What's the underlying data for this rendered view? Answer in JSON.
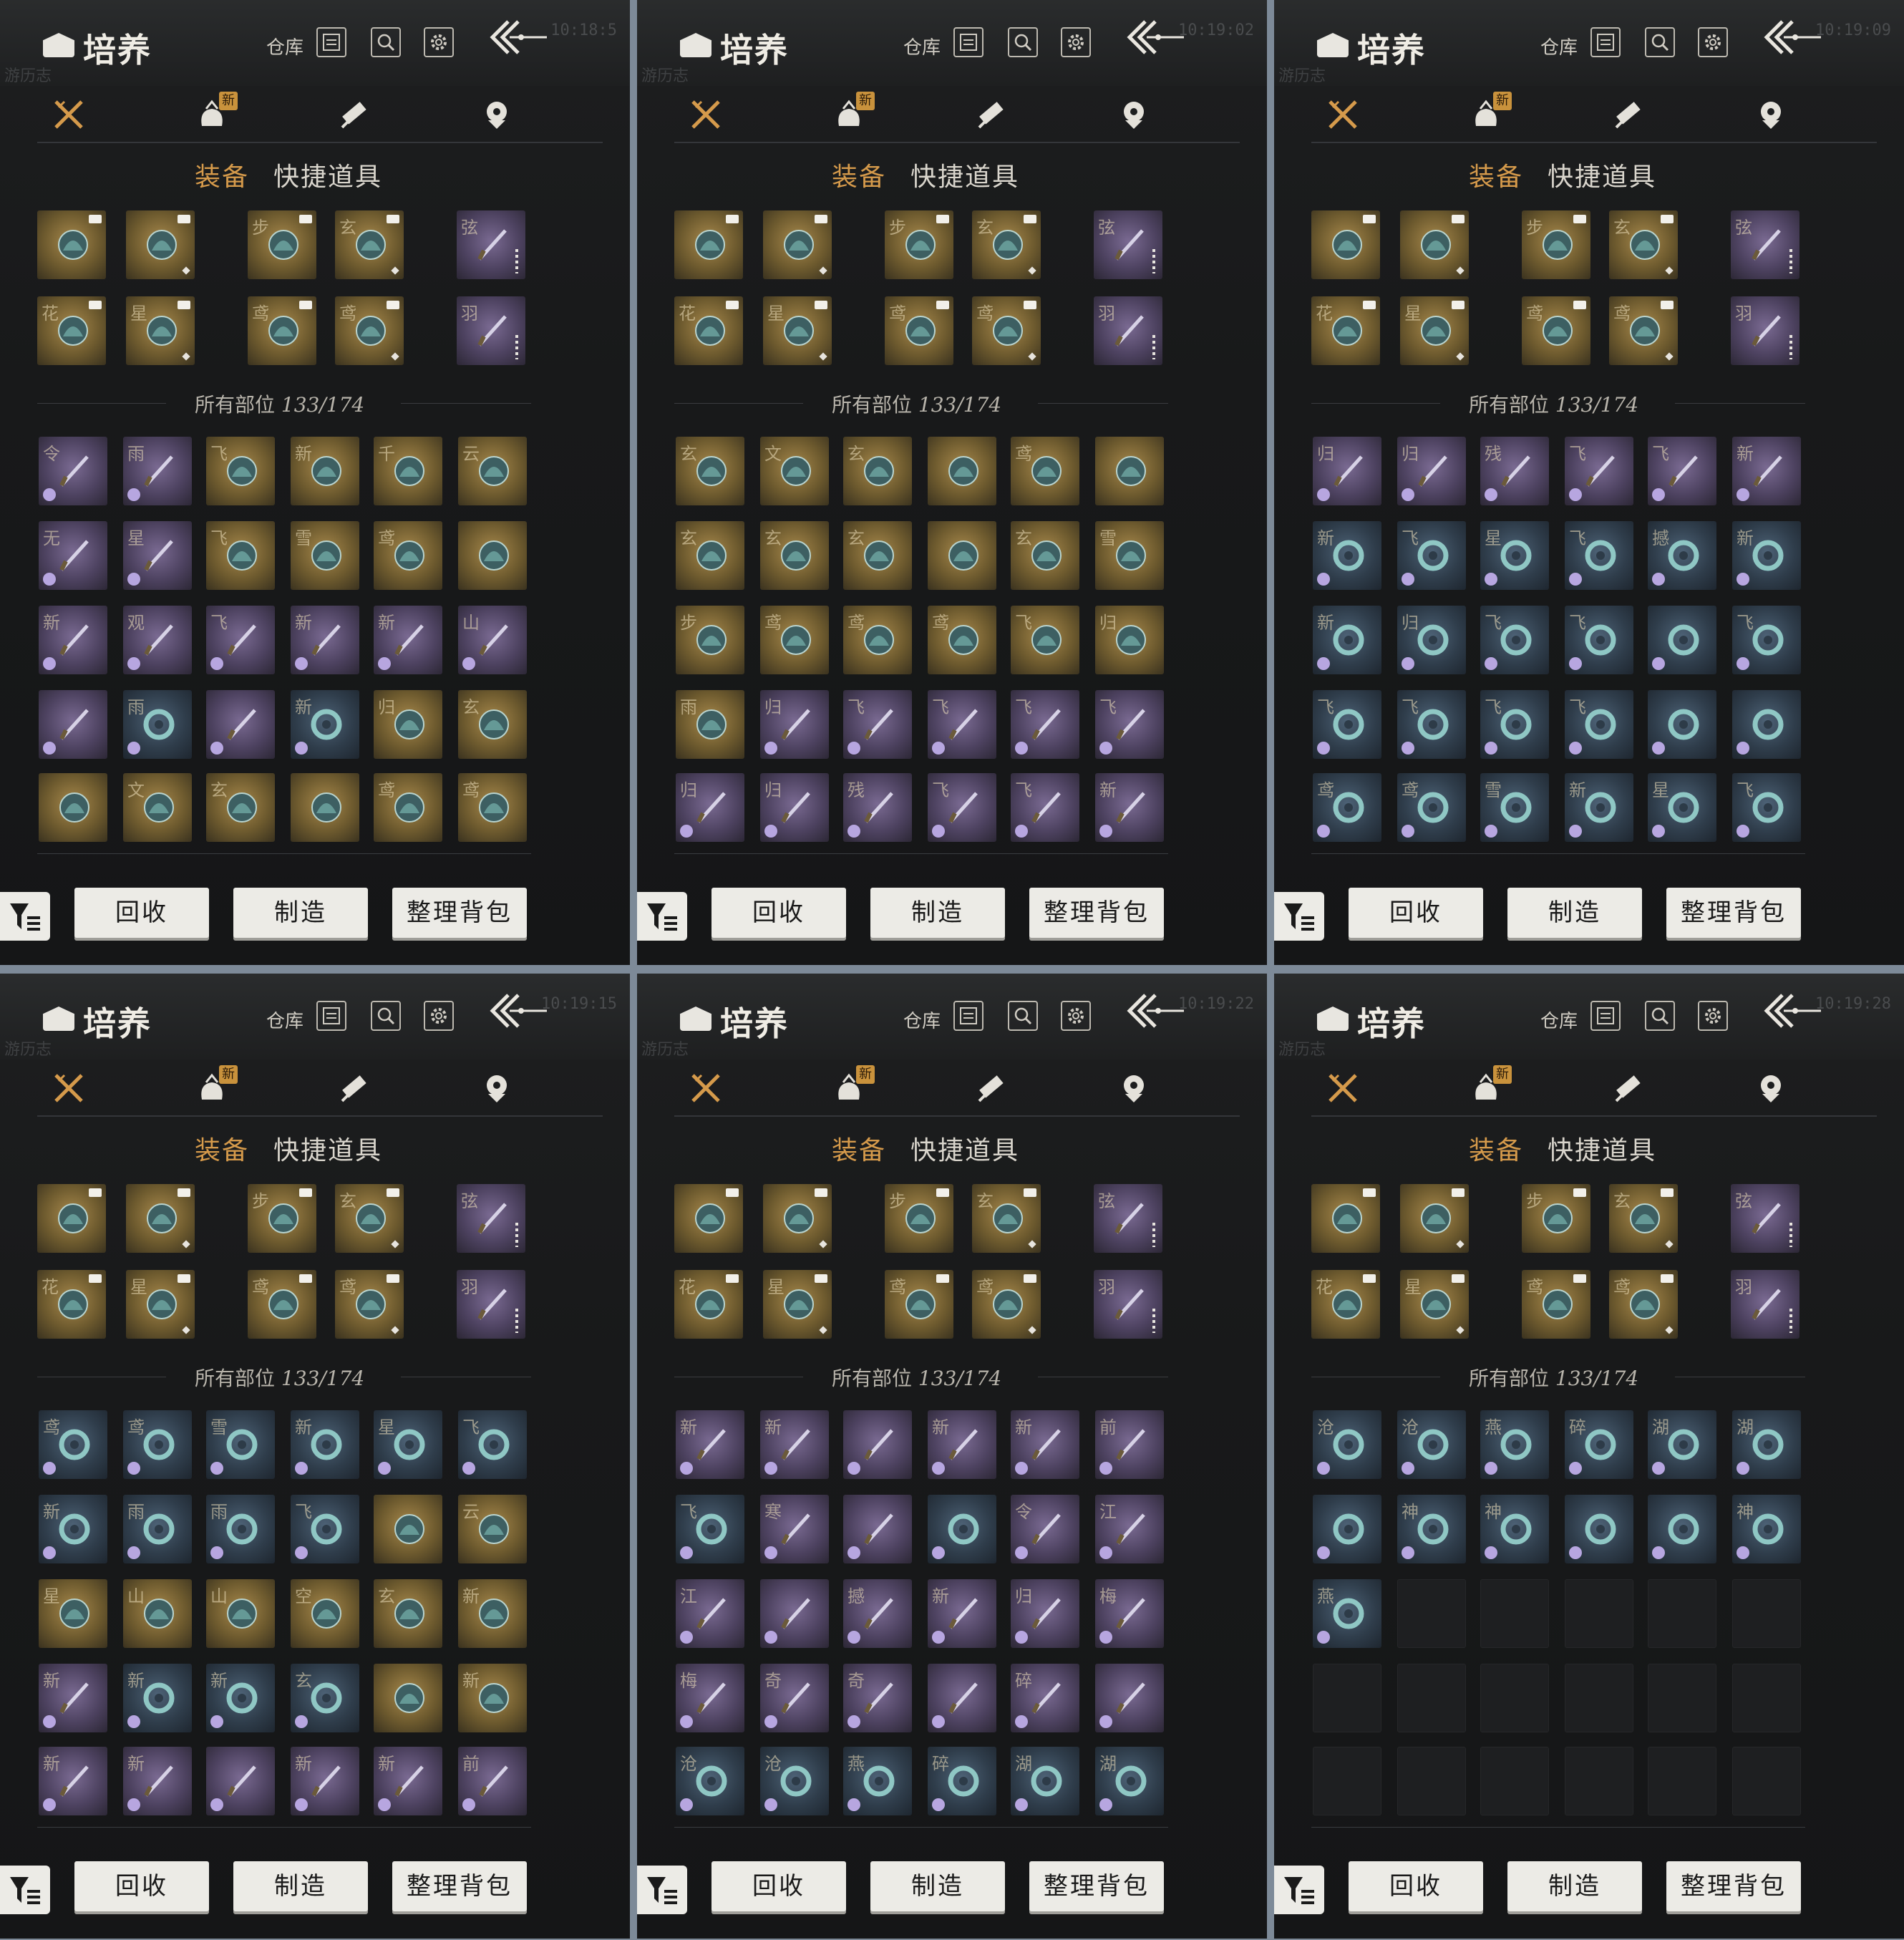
{
  "panels": [
    {
      "time": "10:18:5",
      "title": "培养",
      "warehouse": "仓库",
      "subtabs": [
        "装备",
        "快捷道具"
      ],
      "new_badge": "新",
      "count_label": "所有部位",
      "count_value": "133/174",
      "ghost_left": "游历志",
      "buttons": {
        "recycle": "回收",
        "craft": "制造",
        "sort": "整理背包"
      },
      "grid": [
        [
          "令",
          "purple"
        ],
        [
          "雨",
          "purple"
        ],
        [
          "飞",
          "gold"
        ],
        [
          "新",
          "gold"
        ],
        [
          "千",
          "gold"
        ],
        [
          "云",
          "gold"
        ],
        [
          "无",
          "purple"
        ],
        [
          "星",
          "purple"
        ],
        [
          "飞",
          "gold"
        ],
        [
          "雪",
          "gold"
        ],
        [
          "鸢",
          "gold"
        ],
        [
          "",
          "gold"
        ],
        [
          "新",
          "purple"
        ],
        [
          "观",
          "purple"
        ],
        [
          "飞",
          "purple"
        ],
        [
          "新",
          "purple"
        ],
        [
          "新",
          "purple"
        ],
        [
          "山",
          "purple"
        ],
        [
          "",
          "purple"
        ],
        [
          "雨",
          "blue"
        ],
        [
          "",
          "purple"
        ],
        [
          "新",
          "blue"
        ],
        [
          "归",
          "gold"
        ],
        [
          "玄",
          "gold"
        ],
        [
          "",
          "gold"
        ],
        [
          "文",
          "gold"
        ],
        [
          "玄",
          "gold"
        ],
        [
          "",
          "gold"
        ],
        [
          "鸢",
          "gold"
        ],
        [
          "鸢",
          "gold"
        ]
      ]
    },
    {
      "time": "10:19:02",
      "title": "培养",
      "warehouse": "仓库",
      "subtabs": [
        "装备",
        "快捷道具"
      ],
      "new_badge": "新",
      "count_label": "所有部位",
      "count_value": "133/174",
      "ghost_left": "游历志",
      "buttons": {
        "recycle": "回收",
        "craft": "制造",
        "sort": "整理背包"
      },
      "grid": [
        [
          "玄",
          "gold"
        ],
        [
          "文",
          "gold"
        ],
        [
          "玄",
          "gold"
        ],
        [
          "",
          "gold"
        ],
        [
          "鸢",
          "gold"
        ],
        [
          "",
          "gold"
        ],
        [
          "玄",
          "gold"
        ],
        [
          "玄",
          "gold"
        ],
        [
          "玄",
          "gold"
        ],
        [
          "",
          "gold"
        ],
        [
          "玄",
          "gold"
        ],
        [
          "雪",
          "gold"
        ],
        [
          "步",
          "gold"
        ],
        [
          "鸢",
          "gold"
        ],
        [
          "鸢",
          "gold"
        ],
        [
          "鸢",
          "gold"
        ],
        [
          "飞",
          "gold"
        ],
        [
          "归",
          "gold"
        ],
        [
          "雨",
          "gold"
        ],
        [
          "归",
          "purple"
        ],
        [
          "飞",
          "purple"
        ],
        [
          "飞",
          "purple"
        ],
        [
          "飞",
          "purple"
        ],
        [
          "飞",
          "purple"
        ],
        [
          "归",
          "purple"
        ],
        [
          "归",
          "purple"
        ],
        [
          "残",
          "purple"
        ],
        [
          "飞",
          "purple"
        ],
        [
          "飞",
          "purple"
        ],
        [
          "新",
          "purple"
        ]
      ]
    },
    {
      "time": "10:19:09",
      "title": "培养",
      "warehouse": "仓库",
      "subtabs": [
        "装备",
        "快捷道具"
      ],
      "new_badge": "新",
      "count_label": "所有部位",
      "count_value": "133/174",
      "ghost_left": "游历志",
      "buttons": {
        "recycle": "回收",
        "craft": "制造",
        "sort": "整理背包"
      },
      "grid": [
        [
          "归",
          "purple"
        ],
        [
          "归",
          "purple"
        ],
        [
          "残",
          "purple"
        ],
        [
          "飞",
          "purple"
        ],
        [
          "飞",
          "purple"
        ],
        [
          "新",
          "purple"
        ],
        [
          "新",
          "blue"
        ],
        [
          "飞",
          "blue"
        ],
        [
          "星",
          "blue"
        ],
        [
          "飞",
          "blue"
        ],
        [
          "撼",
          "blue"
        ],
        [
          "新",
          "blue"
        ],
        [
          "新",
          "blue"
        ],
        [
          "归",
          "blue"
        ],
        [
          "飞",
          "blue"
        ],
        [
          "飞",
          "blue"
        ],
        [
          "",
          "blue"
        ],
        [
          "飞",
          "blue"
        ],
        [
          "飞",
          "blue"
        ],
        [
          "飞",
          "blue"
        ],
        [
          "飞",
          "blue"
        ],
        [
          "飞",
          "blue"
        ],
        [
          "",
          "blue"
        ],
        [
          "",
          "blue"
        ],
        [
          "鸢",
          "blue"
        ],
        [
          "鸢",
          "blue"
        ],
        [
          "雪",
          "blue"
        ],
        [
          "新",
          "blue"
        ],
        [
          "星",
          "blue"
        ],
        [
          "飞",
          "blue"
        ]
      ]
    },
    {
      "time": "10:19:15",
      "title": "培养",
      "warehouse": "仓库",
      "subtabs": [
        "装备",
        "快捷道具"
      ],
      "new_badge": "新",
      "count_label": "所有部位",
      "count_value": "133/174",
      "ghost_left": "游历志",
      "buttons": {
        "recycle": "回收",
        "craft": "制造",
        "sort": "整理背包"
      },
      "grid": [
        [
          "鸢",
          "blue"
        ],
        [
          "鸢",
          "blue"
        ],
        [
          "雪",
          "blue"
        ],
        [
          "新",
          "blue"
        ],
        [
          "星",
          "blue"
        ],
        [
          "飞",
          "blue"
        ],
        [
          "新",
          "blue"
        ],
        [
          "雨",
          "blue"
        ],
        [
          "雨",
          "blue"
        ],
        [
          "飞",
          "blue"
        ],
        [
          "",
          "gold"
        ],
        [
          "云",
          "gold"
        ],
        [
          "星",
          "gold"
        ],
        [
          "山",
          "gold"
        ],
        [
          "山",
          "gold"
        ],
        [
          "空",
          "gold"
        ],
        [
          "玄",
          "gold"
        ],
        [
          "新",
          "gold"
        ],
        [
          "新",
          "purple"
        ],
        [
          "新",
          "blue"
        ],
        [
          "新",
          "blue"
        ],
        [
          "玄",
          "blue"
        ],
        [
          "",
          "gold"
        ],
        [
          "新",
          "gold"
        ],
        [
          "新",
          "purple"
        ],
        [
          "新",
          "purple"
        ],
        [
          "",
          "purple"
        ],
        [
          "新",
          "purple"
        ],
        [
          "新",
          "purple"
        ],
        [
          "前",
          "purple"
        ]
      ]
    },
    {
      "time": "10:19:22",
      "title": "培养",
      "warehouse": "仓库",
      "subtabs": [
        "装备",
        "快捷道具"
      ],
      "new_badge": "新",
      "count_label": "所有部位",
      "count_value": "133/174",
      "ghost_left": "游历志",
      "buttons": {
        "recycle": "回收",
        "craft": "制造",
        "sort": "整理背包"
      },
      "grid": [
        [
          "新",
          "purple"
        ],
        [
          "新",
          "purple"
        ],
        [
          "",
          "purple"
        ],
        [
          "新",
          "purple"
        ],
        [
          "新",
          "purple"
        ],
        [
          "前",
          "purple"
        ],
        [
          "飞",
          "blue"
        ],
        [
          "寒",
          "purple"
        ],
        [
          "",
          "purple"
        ],
        [
          "",
          "blue"
        ],
        [
          "令",
          "purple"
        ],
        [
          "江",
          "purple"
        ],
        [
          "江",
          "purple"
        ],
        [
          "",
          "purple"
        ],
        [
          "撼",
          "purple"
        ],
        [
          "新",
          "purple"
        ],
        [
          "归",
          "purple"
        ],
        [
          "梅",
          "purple"
        ],
        [
          "梅",
          "purple"
        ],
        [
          "奇",
          "purple"
        ],
        [
          "奇",
          "purple"
        ],
        [
          "",
          "purple"
        ],
        [
          "碎",
          "purple"
        ],
        [
          "",
          "purple"
        ],
        [
          "沧",
          "blue"
        ],
        [
          "沧",
          "blue"
        ],
        [
          "燕",
          "blue"
        ],
        [
          "碎",
          "blue"
        ],
        [
          "湖",
          "blue"
        ],
        [
          "湖",
          "blue"
        ]
      ]
    },
    {
      "time": "10:19:28",
      "title": "培养",
      "warehouse": "仓库",
      "subtabs": [
        "装备",
        "快捷道具"
      ],
      "new_badge": "新",
      "count_label": "所有部位",
      "count_value": "133/174",
      "ghost_left": "游历志",
      "buttons": {
        "recycle": "回收",
        "craft": "制造",
        "sort": "整理背包"
      },
      "grid": [
        [
          "沧",
          "blue"
        ],
        [
          "沧",
          "blue"
        ],
        [
          "燕",
          "blue"
        ],
        [
          "碎",
          "blue"
        ],
        [
          "湖",
          "blue"
        ],
        [
          "湖",
          "blue"
        ],
        [
          "",
          "blue"
        ],
        [
          "神",
          "blue"
        ],
        [
          "神",
          "blue"
        ],
        [
          "",
          "blue"
        ],
        [
          "",
          "blue"
        ],
        [
          "神",
          "blue"
        ],
        [
          "燕",
          "blue"
        ],
        [
          "",
          "empty"
        ],
        [
          "",
          "empty"
        ],
        [
          "",
          "empty"
        ],
        [
          "",
          "empty"
        ],
        [
          "",
          "empty"
        ],
        [
          "",
          "empty"
        ],
        [
          "",
          "empty"
        ],
        [
          "",
          "empty"
        ],
        [
          "",
          "empty"
        ],
        [
          "",
          "empty"
        ],
        [
          "",
          "empty"
        ],
        [
          "",
          "empty"
        ],
        [
          "",
          "empty"
        ],
        [
          "",
          "empty"
        ],
        [
          "",
          "empty"
        ],
        [
          "",
          "empty"
        ],
        [
          "",
          "empty"
        ]
      ]
    }
  ],
  "equip": [
    [
      "",
      "gold"
    ],
    [
      "",
      "gold"
    ],
    [
      "步",
      "gold"
    ],
    [
      "玄",
      "gold"
    ],
    [
      "弦",
      "purple"
    ],
    [
      "花",
      "gold"
    ],
    [
      "星",
      "gold"
    ],
    [
      "鸢",
      "gold"
    ],
    [
      "鸢",
      "gold"
    ],
    [
      "羽",
      "purple"
    ]
  ],
  "colors": {
    "accent": "#d59a4b",
    "gold": "#8b7440",
    "purple": "#5d4f73",
    "blue": "#3b4b5c",
    "button_bg": "#ecebe6"
  },
  "icons": [
    "book-icon",
    "warehouse-icon",
    "search-icon",
    "settings-icon",
    "back-icon",
    "weapon-tab-icon",
    "bag-tab-icon",
    "scroll-tab-icon",
    "token-tab-icon",
    "filter-icon"
  ]
}
